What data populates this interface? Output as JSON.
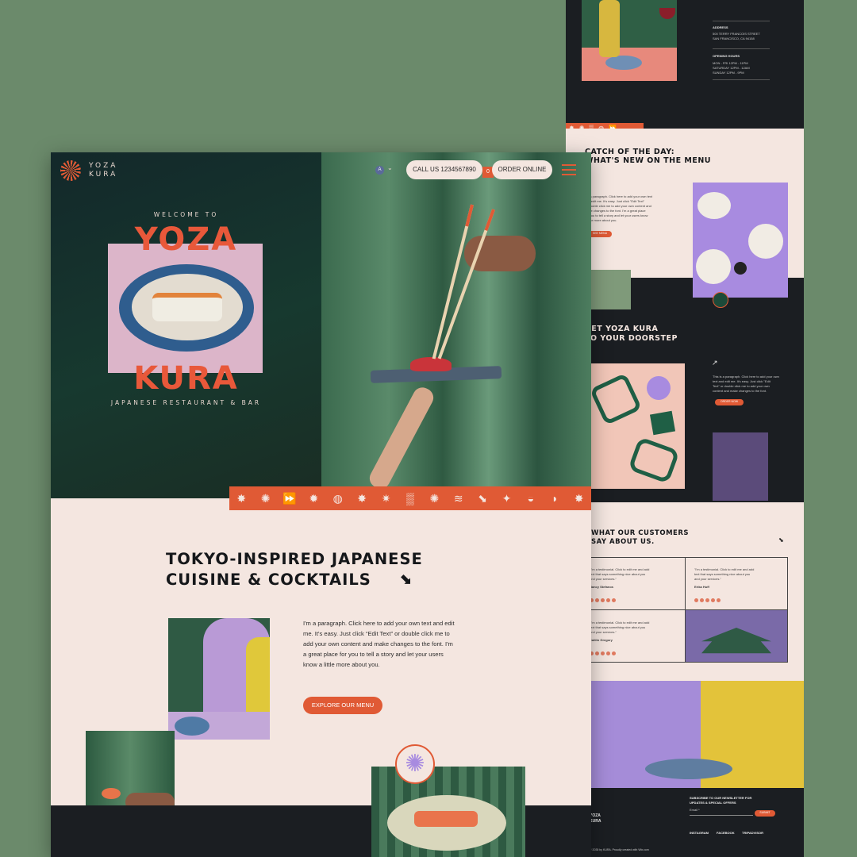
{
  "back": {
    "address_label": "ADDRESS",
    "address_lines": [
      "500 TERRY FRANCOIS STREET",
      "SAN FRANCISCO, CA 94158"
    ],
    "hours_label": "OPENING HOURS",
    "hours_lines": [
      "MON - FRI 12PM - 11PM",
      "SATURDAY 12PM - 12AM",
      "SUNDAY 12PM - 9PM"
    ],
    "catch_title": [
      "CATCH OF THE DAY:",
      "WHAT'S NEW ON THE MENU"
    ],
    "catch_para": [
      "I'm a paragraph. Click here to add your own text",
      "and edit me. It's easy. Just click \"Edit Text\"",
      "or double click me to add your own content and",
      "make changes to the font. I'm a great place",
      "for you to tell a story and let your users know",
      "a little more about you."
    ],
    "catch_btn": "SEE MENU",
    "doorstep_title": [
      "GET YOZA KURA",
      "TO YOUR DOORSTEP"
    ],
    "doorstep_para": [
      "This is a paragraph. Click here to add your own",
      "text and edit me. It's easy. Just click \"Edit",
      "Text\" or double click me to add your own",
      "content and make changes to the font."
    ],
    "doorstep_btn": "ORDER NOW",
    "customers_title": [
      "WHAT OUR CUSTOMERS",
      "SAY ABOUT US."
    ],
    "testimonial_text": [
      "\"I'm a testimonial. Click to edit me and add",
      "text that says something nice about you",
      "and your services.\""
    ],
    "reviewer_1": "Nancy Stefanos",
    "reviewer_2": "Erika Huff",
    "reviewer_3": "Caitlin Gregory",
    "newsletter_title": [
      "SUBSCRIBE TO OUR NEWSLETTER FOR",
      "UPDATES & SPECIAL OFFERS"
    ],
    "email_label": "Email *",
    "submit": "SUBMIT",
    "social": [
      "INSTAGRAM",
      "FACEBOOK",
      "TRIPADVISOR"
    ],
    "footer_brand": [
      "YOZA",
      "KURA"
    ],
    "copyright": "© 2035 by KURA. Proudly created with Wix.com"
  },
  "front": {
    "brand_line1": "YOZA",
    "brand_line2": "KURA",
    "lang": "A",
    "call_label": "CALL US 1234567890",
    "order_label": "ORDER ONLINE",
    "cart_count": "0",
    "welcome": "WELCOME TO",
    "word1": "YOZA",
    "word2": "KURA",
    "subtitle": "JAPANESE RESTAURANT & BAR",
    "headline_line1": "TOKYO-INSPIRED JAPANESE",
    "headline_line2": "CUISINE & COCKTAILS",
    "paragraph": [
      "I'm a paragraph. Click here to add your own text and edit",
      "me. It's easy. Just click “Edit Text” or double click me to",
      "add your own content and make changes to the font. I'm",
      "a great place for you to tell a story and let your users",
      "know a little more about you."
    ],
    "menu_btn": "EXPLORE OUR MENU",
    "strip_icons": [
      "✸",
      "✺",
      "⏩",
      "✹",
      "◍",
      "✸",
      "✷",
      "▒",
      "✺",
      "≋",
      "⬊",
      "✦",
      "◒",
      "◗",
      "✸"
    ]
  },
  "colors": {
    "accent": "#e05a35",
    "cream": "#f4e6e0",
    "dark": "#1b1e22",
    "bg": "#6b8a6b"
  }
}
